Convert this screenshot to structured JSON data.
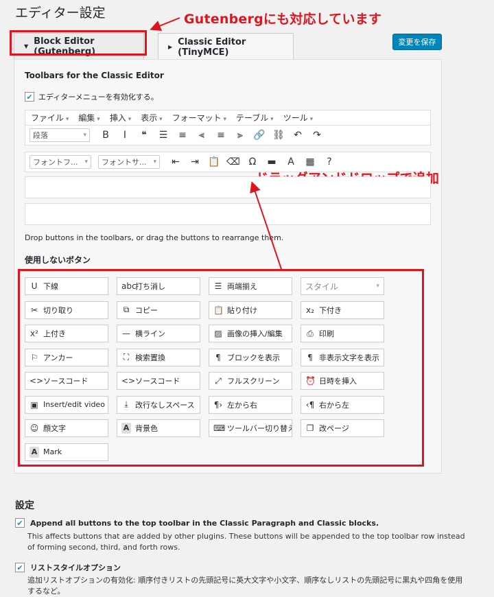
{
  "page": {
    "title": "エディター設定"
  },
  "annotations": {
    "gutenberg_note": "Gutenbergにも対応しています",
    "drag_note": "ドラッグアンドドロップで追加"
  },
  "colors": {
    "accent": "#0085ba",
    "annotation": "#e0141c"
  },
  "tabs": [
    {
      "label": "Block Editor (Gutenberg)",
      "icon": "triangle-down-icon",
      "active": false
    },
    {
      "label": "Classic Editor (TinyMCE)",
      "icon": "triangle-right-icon",
      "active": true
    }
  ],
  "save_button": "変更を保存",
  "panel": {
    "heading": "Toolbars for the Classic Editor",
    "enable_menu_label": "エディターメニューを有効化する。",
    "enable_menu_checked": true,
    "menubar": [
      "ファイル",
      "編集",
      "挿入",
      "表示",
      "フォーマット",
      "テーブル",
      "ツール"
    ],
    "toolbar1": {
      "select": "段落",
      "icons": [
        {
          "icon": "bold-icon",
          "glyph": "B"
        },
        {
          "icon": "italic-icon",
          "glyph": "I"
        },
        {
          "icon": "blockquote-icon",
          "glyph": "❝"
        },
        {
          "icon": "bullet-list-icon",
          "glyph": "☰"
        },
        {
          "icon": "numbered-list-icon",
          "glyph": "≡"
        },
        {
          "icon": "align-left-icon",
          "glyph": "⫷"
        },
        {
          "icon": "align-center-icon",
          "glyph": "≡"
        },
        {
          "icon": "align-right-icon",
          "glyph": "⫸"
        },
        {
          "icon": "link-icon",
          "glyph": "🔗"
        },
        {
          "icon": "unlink-icon",
          "glyph": "⛓"
        },
        {
          "icon": "undo-icon",
          "glyph": "↶"
        },
        {
          "icon": "redo-icon",
          "glyph": "↷"
        }
      ]
    },
    "toolbar2": {
      "select1": "フォントフ...",
      "select2": "フォントサ...",
      "icons": [
        {
          "icon": "indent-icon",
          "glyph": "⇤"
        },
        {
          "icon": "outdent-icon",
          "glyph": "⇥"
        },
        {
          "icon": "paste-text-icon",
          "glyph": "📋"
        },
        {
          "icon": "eraser-icon",
          "glyph": "⌫"
        },
        {
          "icon": "omega-icon",
          "glyph": "Ω"
        },
        {
          "icon": "horizontal-rule-icon",
          "glyph": "▬"
        },
        {
          "icon": "text-color-icon",
          "glyph": "A"
        },
        {
          "icon": "table-icon",
          "glyph": "▦"
        },
        {
          "icon": "help-icon",
          "glyph": "?"
        }
      ]
    },
    "drop_hint": "Drop buttons in the toolbars, or drag the buttons to rearrange them.",
    "unused_heading": "使用しないボタン",
    "unused_buttons": [
      [
        {
          "icon": "underline-icon",
          "glyph": "U",
          "label": "下線"
        },
        {
          "icon": "strikethrough-icon",
          "glyph": "abc",
          "label": "打ち消し"
        },
        {
          "icon": "justify-icon",
          "glyph": "☰",
          "label": "両端揃え"
        },
        {
          "icon": "style-select-icon",
          "glyph": "",
          "label": "スタイル",
          "select": true
        }
      ],
      [
        {
          "icon": "cut-icon",
          "glyph": "✂",
          "label": "切り取り"
        },
        {
          "icon": "copy-icon",
          "glyph": "⧉",
          "label": "コピー"
        },
        {
          "icon": "paste-icon",
          "glyph": "📋",
          "label": "貼り付け"
        },
        {
          "icon": "subscript-icon",
          "glyph": "x₂",
          "label": "下付き"
        }
      ],
      [
        {
          "icon": "superscript-icon",
          "glyph": "x²",
          "label": "上付き"
        },
        {
          "icon": "horizontal-line-icon",
          "glyph": "—",
          "label": "横ライン"
        },
        {
          "icon": "image-icon",
          "glyph": "▨",
          "label": "画像の挿入/編集"
        },
        {
          "icon": "print-icon",
          "glyph": "⎙",
          "label": "印刷"
        }
      ],
      [
        {
          "icon": "anchor-icon",
          "glyph": "⚐",
          "label": "アンカー"
        },
        {
          "icon": "search-replace-icon",
          "glyph": "⛶",
          "label": "検索置換"
        },
        {
          "icon": "pilcrow-icon",
          "glyph": "¶",
          "label": "ブロックを表示"
        },
        {
          "icon": "pilcrow-icon",
          "glyph": "¶",
          "label": "非表示文字を表示"
        }
      ],
      [
        {
          "icon": "code-icon",
          "glyph": "<>",
          "label": "ソースコード"
        },
        {
          "icon": "code-icon",
          "glyph": "<>",
          "label": "ソースコード"
        },
        {
          "icon": "fullscreen-icon",
          "glyph": "⤢",
          "label": "フルスクリーン"
        },
        {
          "icon": "clock-icon",
          "glyph": "⏰",
          "label": "日時を挿入"
        }
      ],
      [
        {
          "icon": "video-icon",
          "glyph": "▣",
          "label": "Insert/edit video"
        },
        {
          "icon": "nonbreaking-space-icon",
          "glyph": "⤓",
          "label": "改行なしスペース"
        },
        {
          "icon": "ltr-icon",
          "glyph": "¶›",
          "label": "左から右"
        },
        {
          "icon": "rtl-icon",
          "glyph": "‹¶",
          "label": "右から左"
        }
      ],
      [
        {
          "icon": "emoticon-icon",
          "glyph": "☺",
          "label": "顔文字"
        },
        {
          "icon": "background-color-icon",
          "glyph": "A",
          "label": "背景色",
          "boxed": true
        },
        {
          "icon": "toolbar-toggle-icon",
          "glyph": "⌨",
          "label": "ツールバー切り替え"
        },
        {
          "icon": "page-break-icon",
          "glyph": "❐",
          "label": "改ページ"
        }
      ],
      [
        {
          "icon": "mark-icon",
          "glyph": "A",
          "label": "Mark",
          "boxed": true
        }
      ]
    ]
  },
  "settings": {
    "heading": "設定",
    "options": [
      {
        "label": "Append all buttons to the top toolbar in the Classic Paragraph and Classic blocks.",
        "checked": true,
        "description": "This affects buttons that are added by other plugins. These buttons will be appended to the top toolbar row instead of forming second, third, and forth rows."
      },
      {
        "label": "リストスタイルオプション",
        "checked": true,
        "description": "追加リストオプションの有効化: 順序付きリストの先頭記号に英大文字や小文字、順序なしリストの先頭記号に黒丸や四角を使用するなど。"
      }
    ]
  }
}
